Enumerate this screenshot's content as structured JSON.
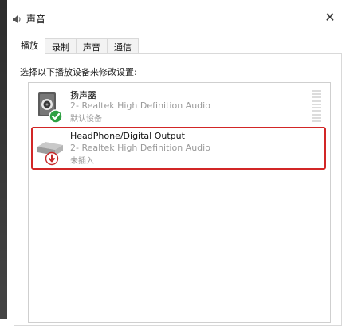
{
  "window": {
    "title": "声音",
    "close_glyph": "✕"
  },
  "tabs": [
    {
      "label": "播放",
      "active": true
    },
    {
      "label": "录制",
      "active": false
    },
    {
      "label": "声音",
      "active": false
    },
    {
      "label": "通信",
      "active": false
    }
  ],
  "instruction": "选择以下播放设备来修改设置:",
  "devices": [
    {
      "name": "扬声器",
      "driver": "2- Realtek High Definition Audio",
      "status": "默认设备",
      "icon": "speaker-icon",
      "badge": "default-check-badge-icon"
    },
    {
      "name": "HeadPhone/Digital Output",
      "driver": "2- Realtek High Definition Audio",
      "status": "未插入",
      "icon": "digital-output-icon",
      "badge": "unplugged-arrow-badge-icon"
    }
  ],
  "colors": {
    "highlight_border": "#d22626",
    "check_badge": "#2ea043",
    "unplugged_badge": "#c62828"
  }
}
